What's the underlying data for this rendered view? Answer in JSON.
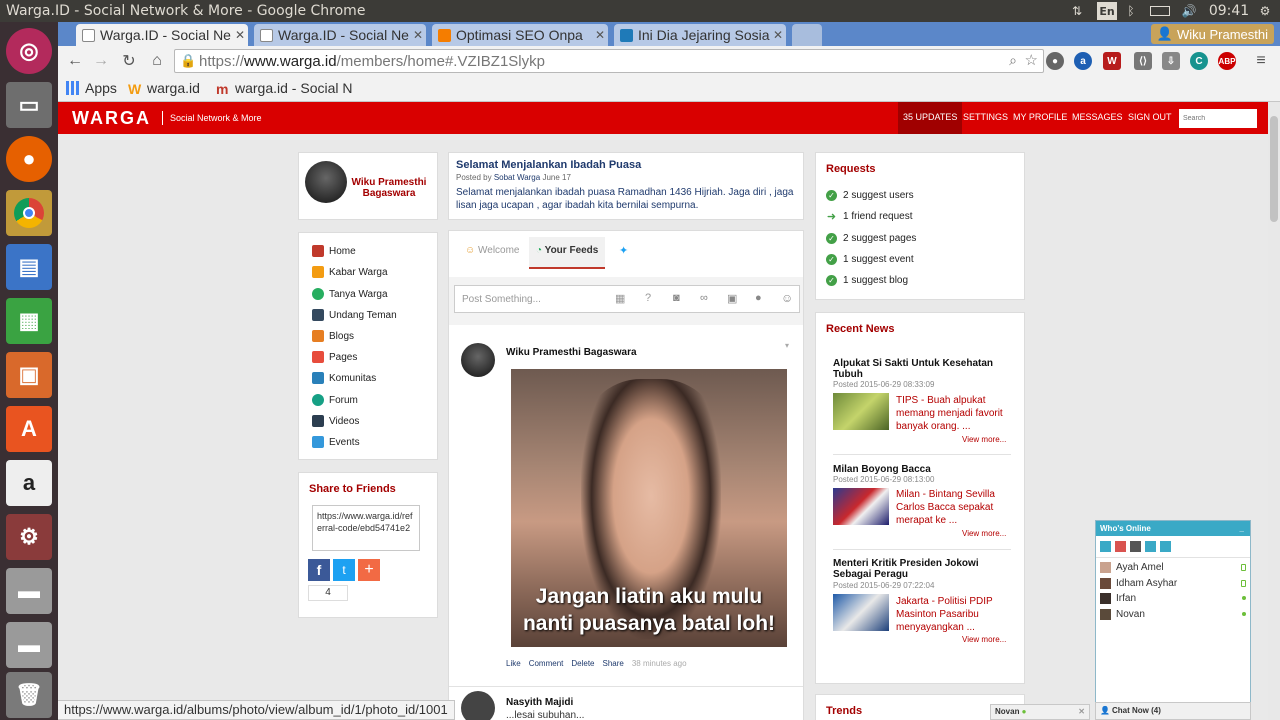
{
  "window": {
    "title": "Warga.ID - Social Network & More - Google Chrome",
    "lang_indicator": "En",
    "clock": "09:41",
    "user": "Wiku Pramesthi"
  },
  "tabs": [
    {
      "label": "Warga.ID - Social Ne",
      "active": true
    },
    {
      "label": "Warga.ID - Social Ne",
      "active": false
    },
    {
      "label": "Optimasi SEO Onpa",
      "active": false
    },
    {
      "label": "Ini Dia Jejaring Sosia",
      "active": false
    }
  ],
  "address": {
    "scheme": "https://",
    "host": "www.warga.id",
    "path": "/members/home#.VZIBZ1Slykp"
  },
  "bookmarks": [
    {
      "label": "Apps",
      "icon": "apps-grid-icon"
    },
    {
      "label": "warga.id",
      "icon": "warga-w-icon"
    },
    {
      "label": "warga.id - Social N",
      "icon": "warga-m-icon"
    }
  ],
  "site": {
    "logo": "WARGA",
    "tagline": "Social Network & More",
    "nav": {
      "updates": "35 UPDATES",
      "settings": "SETTINGS",
      "profile": "MY PROFILE",
      "messages": "MESSAGES",
      "signout": "SIGN OUT"
    },
    "search_placeholder": "Search"
  },
  "profile": {
    "name": "Wiku Pramesthi Bagaswara"
  },
  "menu": [
    {
      "label": "Home",
      "icon": "home-icon",
      "color": "#c0392b"
    },
    {
      "label": "Kabar Warga",
      "icon": "rss-icon",
      "color": "#f39c12"
    },
    {
      "label": "Tanya Warga",
      "icon": "question-icon",
      "color": "#27ae60"
    },
    {
      "label": "Undang Teman",
      "icon": "person-icon",
      "color": "#34495e"
    },
    {
      "label": "Blogs",
      "icon": "blogger-icon",
      "color": "#e67e22"
    },
    {
      "label": "Pages",
      "icon": "pages-icon",
      "color": "#e74c3c"
    },
    {
      "label": "Komunitas",
      "icon": "group-icon",
      "color": "#2980b9"
    },
    {
      "label": "Forum",
      "icon": "forum-icon",
      "color": "#16a085"
    },
    {
      "label": "Videos",
      "icon": "video-icon",
      "color": "#2c3e50"
    },
    {
      "label": "Events",
      "icon": "calendar-icon",
      "color": "#3498db"
    }
  ],
  "share": {
    "title": "Share to Friends",
    "url": "https://www.warga.id/referral-code/ebd54741e2",
    "count": "4"
  },
  "announcement": {
    "title": "Selamat Menjalankan Ibadah Puasa",
    "posted_by_prefix": "Posted by",
    "author": "Sobat Warga",
    "date": "June 17",
    "body": "Selamat menjalankan ibadah puasa Ramadhan 1436 Hijriah. Jaga diri , jaga lisan jaga ucapan , agar ibadah kita bernilai sempurna."
  },
  "feed_tabs": {
    "welcome": "Welcome",
    "your_feeds": "Your Feeds"
  },
  "composer": {
    "placeholder": "Post Something..."
  },
  "post": {
    "author": "Wiku Pramesthi Bagaswara",
    "caption_line1": "Jangan liatin aku mulu",
    "caption_line2": "nanti puasanya batal loh!",
    "actions": {
      "like": "Like",
      "comment": "Comment",
      "delete": "Delete",
      "share": "Share"
    },
    "time": "38 minutes ago"
  },
  "post2": {
    "author": "Nasyith Majidi",
    "snippet": "...lesai subuhan..."
  },
  "requests": {
    "title": "Requests",
    "items": [
      {
        "label": "2 suggest users"
      },
      {
        "label": "1 friend request"
      },
      {
        "label": "2 suggest pages"
      },
      {
        "label": "1 suggest event"
      },
      {
        "label": "1 suggest blog"
      }
    ]
  },
  "news": {
    "title": "Recent News",
    "items": [
      {
        "title": "Alpukat Si Sakti Untuk Kesehatan Tubuh",
        "date": "Posted 2015-06-29 08:33:09",
        "text": "TIPS - Buah alpukat memang menjadi favorit banyak orang. ...",
        "more": "View more..."
      },
      {
        "title": "Milan Boyong Bacca",
        "date": "Posted 2015-06-29 08:13:00",
        "text": "Milan - Bintang Sevilla Carlos Bacca sepakat merapat ke ...",
        "more": "View more..."
      },
      {
        "title": "Menteri Kritik Presiden Jokowi Sebagai Peragu",
        "date": "Posted 2015-06-29 07:22:04",
        "text": "Jakarta - Politisi PDIP Masinton Pasaribu menyayangkan ...",
        "more": "View more..."
      }
    ]
  },
  "trends": {
    "title": "Trends"
  },
  "online": {
    "title": "Who's Online",
    "users": [
      {
        "name": "Ayah Amel"
      },
      {
        "name": "Idham Asyhar"
      },
      {
        "name": "Irfan"
      },
      {
        "name": "Novan"
      }
    ],
    "chat_label": "Chat Now (4)",
    "chip": "Novan"
  },
  "status_url": "https://www.warga.id/albums/photo/view/album_id/1/photo_id/1001"
}
